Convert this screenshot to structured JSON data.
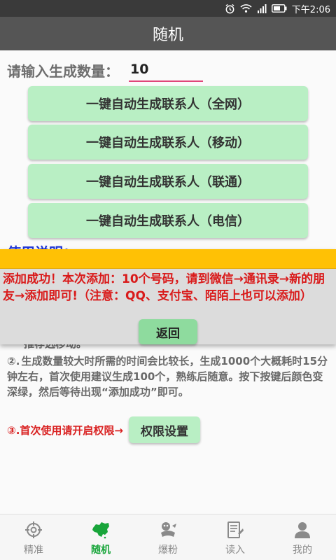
{
  "status_bar": {
    "time": "下午2:06"
  },
  "app_bar": {
    "title": "随机"
  },
  "count": {
    "label": "请输入生成数量：",
    "value": "10"
  },
  "generate_buttons": [
    "一键自动生成联系人（全网）",
    "一键自动生成联系人（移动）",
    "一键自动生成联系人（联通）",
    "一键自动生成联系人（电信）"
  ],
  "usage": {
    "title": "使用说明：",
    "partial_line": "推荐选移动。",
    "item2_num": "②.",
    "item2_text": "生成数量较大时所需的时间会比较长，生成1000个大概耗时15分钟左右，首次使用建议生成100个，熟练后随意。按下按键后颜色变深绿，然后等待出现“添加成功”即可。",
    "item3_text": "③.首次使用请开启权限→",
    "permission_button": "权限设置"
  },
  "dialog": {
    "message": "添加成功！本次添加：10个号码，请到微信→通讯录→新的朋友→添加即可!（注意：QQ、支付宝、陌陌上也可以添加）",
    "back_button": "返回"
  },
  "nav": {
    "items": [
      {
        "label": "精准",
        "icon": "target-icon"
      },
      {
        "label": "随机",
        "icon": "china-map-icon"
      },
      {
        "label": "爆粉",
        "icon": "mascot-icon"
      },
      {
        "label": "读入",
        "icon": "document-import-icon"
      },
      {
        "label": "我的",
        "icon": "person-icon"
      }
    ],
    "active_index": 1
  },
  "colors": {
    "app_bar": "#555555",
    "button_green": "#b9efc4",
    "dialog_bar": "#ffc105",
    "dialog_text": "#d91a1a",
    "usage_title": "#1f35d6",
    "nav_active": "#18a53a"
  }
}
